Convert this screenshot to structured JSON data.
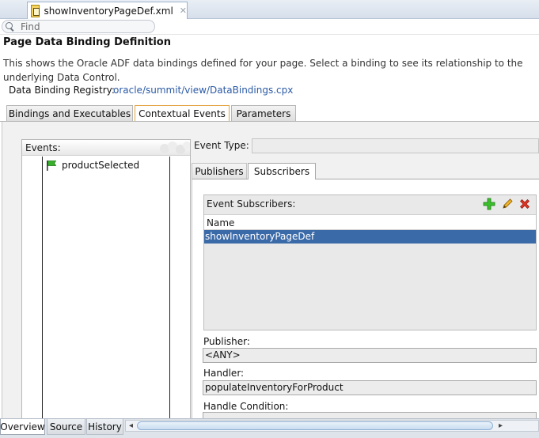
{
  "editor_tab": {
    "label": "showInventoryPageDef.xml",
    "close": "✕"
  },
  "find": {
    "placeholder": "Find"
  },
  "header": {
    "title": "Page Data Binding Definition",
    "description": "This shows the Oracle ADF data bindings defined for your page. Select a binding to see its relationship to the underlying Data Control.",
    "registry_label": "Data Binding Registry:",
    "registry_link": "oracle/summit/view/DataBindings.cpx"
  },
  "main_tabs": [
    {
      "label": "Bindings and Executables",
      "active": false
    },
    {
      "label": "Contextual Events",
      "active": true
    },
    {
      "label": "Parameters",
      "active": false
    }
  ],
  "events": {
    "label": "Events:",
    "items": [
      {
        "label": "productSelected",
        "icon": "green-flag-icon"
      }
    ]
  },
  "event_type": {
    "label": "Event Type:",
    "value": ""
  },
  "sub_tabs": [
    {
      "label": "Publishers",
      "active": false
    },
    {
      "label": "Subscribers",
      "active": true
    }
  ],
  "subscribers": {
    "label": "Event Subscribers:",
    "column": "Name",
    "rows": [
      "showInventoryPageDef"
    ],
    "tools": {
      "add": "add-icon",
      "edit": "edit-pencil-icon",
      "delete": "delete-icon"
    }
  },
  "fields": {
    "publisher_label": "Publisher:",
    "publisher_value": "<ANY>",
    "handler_label": "Handler:",
    "handler_value": "populateInventoryForProduct",
    "condition_label": "Handle Condition:"
  },
  "bottom_tabs": [
    {
      "label": "Overview",
      "active": true
    },
    {
      "label": "Source",
      "active": false
    },
    {
      "label": "History",
      "active": false
    }
  ],
  "colors": {
    "selection": "#3b6aa8",
    "active_tab_border": "#e2a340",
    "link": "#2b5aa6"
  }
}
